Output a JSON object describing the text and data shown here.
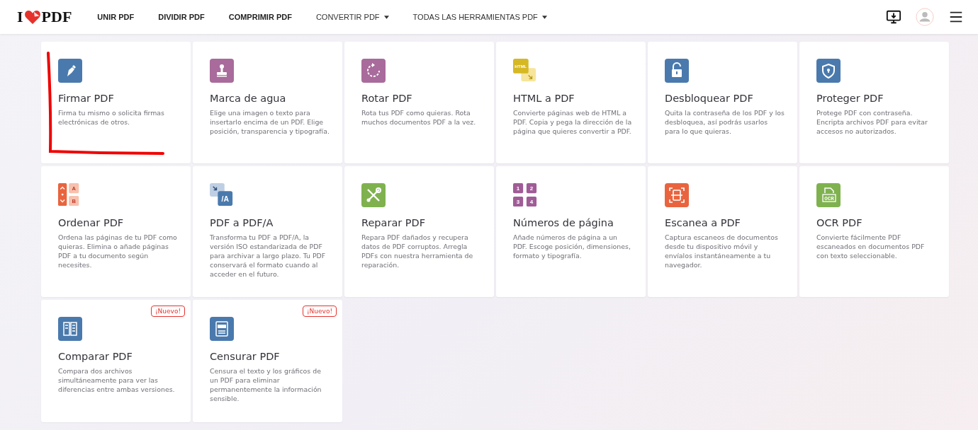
{
  "logo": {
    "left": "I",
    "right": "PDF"
  },
  "nav": [
    {
      "label": "UNIR PDF",
      "dropdown": false
    },
    {
      "label": "DIVIDIR PDF",
      "dropdown": false
    },
    {
      "label": "COMPRIMIR PDF",
      "dropdown": false
    },
    {
      "label": "CONVERTIR PDF",
      "dropdown": true
    },
    {
      "label": "TODAS LAS HERRAMIENTAS PDF",
      "dropdown": true
    }
  ],
  "tools": [
    {
      "kind": "sign",
      "title": "Firmar PDF",
      "description": "Firma tu mismo o solicita firmas electrónicas de otros."
    },
    {
      "kind": "watermark",
      "title": "Marca de agua",
      "description": "Elige una imagen o texto para insertarlo encima de un PDF. Elige posición, transparencia y tipografía."
    },
    {
      "kind": "rotate",
      "title": "Rotar PDF",
      "description": "Rota tus PDF como quieras. Rota muchos documentos PDF a la vez."
    },
    {
      "kind": "html",
      "title": "HTML a PDF",
      "description": "Convierte páginas web de HTML a PDF. Copia y pega la dirección de la página que quieres convertir a PDF.",
      "icon_labels": [
        "HTML"
      ]
    },
    {
      "kind": "unlock",
      "title": "Desbloquear PDF",
      "description": "Quita la contraseña de los PDF y los desbloquea, así podrás usarlos para lo que quieras."
    },
    {
      "kind": "protect",
      "title": "Proteger PDF",
      "description": "Protege PDF con contraseña. Encripta archivos PDF para evitar accesos no autorizados."
    },
    {
      "kind": "organize",
      "title": "Ordenar PDF",
      "description": "Ordena las páginas de tu PDF como quieras. Elimina o añade páginas PDF a tu documento según necesites.",
      "icon_labels": [
        "A",
        "B"
      ]
    },
    {
      "kind": "pdfa",
      "title": "PDF a PDF/A",
      "description": "Transforma tu PDF a PDF/A, la versión ISO estandarizada de PDF para archivar a largo plazo. Tu PDF conservará el formato cuando al acceder en el futuro.",
      "icon_labels": [
        "/A"
      ]
    },
    {
      "kind": "repair",
      "title": "Reparar PDF",
      "description": "Repara PDF dañados y recupera datos de PDF corruptos. Arregla PDFs con nuestra herramienta de reparación."
    },
    {
      "kind": "numbers",
      "title": "Números de página",
      "description": "Añade números de página a un PDF. Escoge posición, dimensiones, formato y tipografía.",
      "icon_labels": [
        "1",
        "2",
        "3",
        "4"
      ]
    },
    {
      "kind": "scan",
      "title": "Escanea a PDF",
      "description": "Captura escaneos de documentos desde tu dispositivo móvil y envíalos instantáneamente a tu navegador."
    },
    {
      "kind": "ocr",
      "title": "OCR PDF",
      "description": "Convierte fácilmente PDF escaneados en documentos PDF con texto seleccionable.",
      "icon_labels": [
        "OCR"
      ]
    },
    {
      "kind": "compare",
      "title": "Comparar PDF",
      "description": "Compara dos archivos simultáneamente para ver las diferencias entre ambas versiones.",
      "badge": "¡Nuevo!"
    },
    {
      "kind": "redact",
      "title": "Censurar PDF",
      "description": "Censura el texto y los gráficos de un PDF para eliminar permanentemente la información sensible.",
      "badge": "¡Nuevo!"
    }
  ]
}
